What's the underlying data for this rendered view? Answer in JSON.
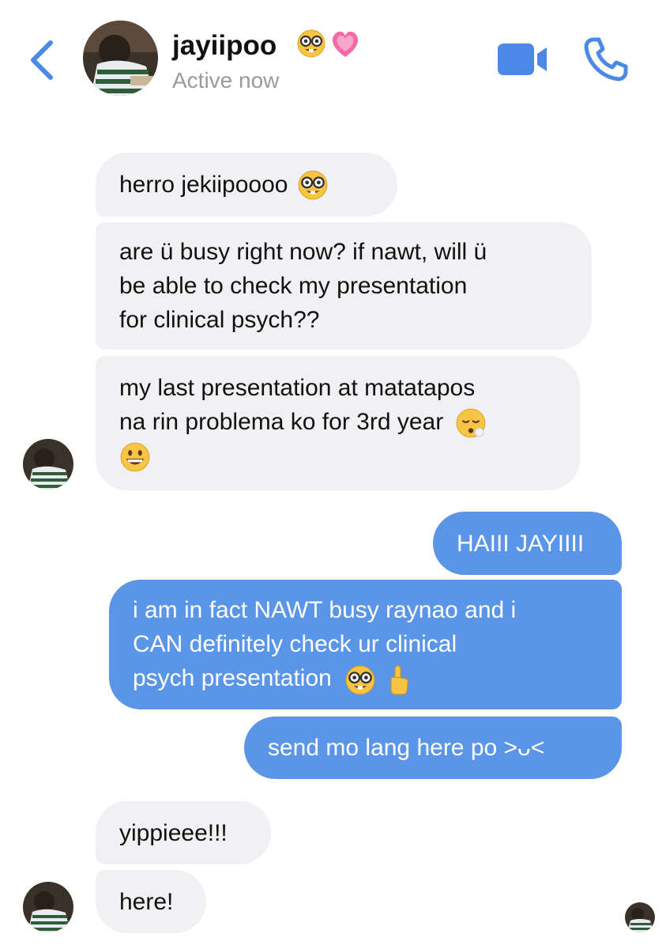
{
  "header": {
    "contact_name": "jayiipoo",
    "status": "Active now",
    "title_emojis": [
      "nerd-face-emoji",
      "growing-heart-emoji"
    ],
    "icons": {
      "back": "chevron-left-icon",
      "video": "video-camera-icon",
      "call": "phone-icon"
    },
    "accent_color": "#4a8ae6"
  },
  "messages": [
    {
      "direction": "incoming",
      "lines": [
        "herro jekiipoooo"
      ],
      "emojis": [
        "nerd-face-emoji"
      ]
    },
    {
      "direction": "incoming",
      "lines": [
        "are ü busy right now? if nawt, will ü",
        "be able to check my presentation",
        "for clinical psych??"
      ]
    },
    {
      "direction": "incoming",
      "lines": [
        "my last presentation at matatapos",
        "na rin problema ko for 3rd year"
      ],
      "emojis": [
        "sighing-face-emoji",
        "grinning-face-emoji"
      ]
    },
    {
      "direction": "outgoing",
      "lines": [
        "HAIII JAYIIII"
      ]
    },
    {
      "direction": "outgoing",
      "lines": [
        "i am in fact NAWT busy raynao and i",
        "CAN definitely check ur clinical",
        "psych presentation"
      ],
      "emojis": [
        "nerd-face-emoji",
        "index-pointing-up-emoji"
      ]
    },
    {
      "direction": "outgoing",
      "lines": [
        "send mo lang here po >ᴗ<"
      ]
    },
    {
      "direction": "incoming",
      "lines": [
        "yippieee!!!"
      ]
    },
    {
      "direction": "incoming",
      "lines": [
        "here!"
      ]
    }
  ],
  "colors": {
    "incoming_bubble": "#f1f1f4",
    "outgoing_bubble": "#5a95e8",
    "status_gray": "#9a9a9e"
  }
}
